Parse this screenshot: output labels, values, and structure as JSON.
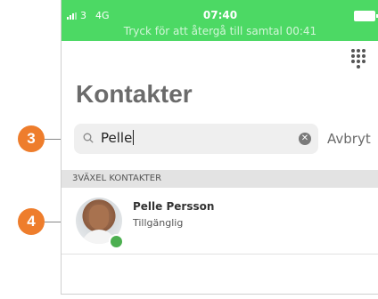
{
  "status_bar": {
    "carrier": "3",
    "network": "4G",
    "time": "07:40",
    "call_banner": "Tryck för att återgå till samtal 00:41",
    "bar_color": "#4cd964"
  },
  "header": {
    "keypad_icon": "dialpad-icon",
    "title": "Kontakter"
  },
  "search": {
    "value": "Pelle",
    "cancel_label": "Avbryt",
    "search_icon": "search-icon",
    "clear_icon": "clear-icon"
  },
  "section": {
    "title": "3VÄXEL KONTAKTER"
  },
  "contacts": [
    {
      "name": "Pelle Persson",
      "status": "Tillgänglig",
      "presence_color": "#4caf50"
    }
  ],
  "callouts": [
    {
      "label": "3"
    },
    {
      "label": "4"
    }
  ],
  "accent_color": "#ee7d2c"
}
